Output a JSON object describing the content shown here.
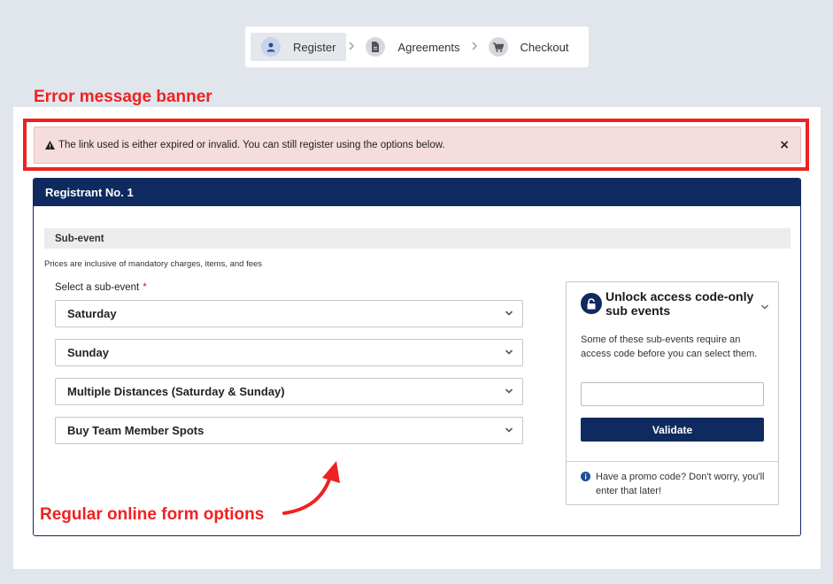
{
  "stepper": {
    "steps": [
      {
        "label": "Register",
        "icon": "user-icon",
        "active": true
      },
      {
        "label": "Agreements",
        "icon": "document-icon",
        "active": false
      },
      {
        "label": "Checkout",
        "icon": "cart-icon",
        "active": false
      }
    ]
  },
  "annotations": {
    "banner_label": "Error message banner",
    "form_label": "Regular online form options"
  },
  "banner": {
    "message": "The link used is either expired or invalid. You can still register using the options below.",
    "close_symbol": "×"
  },
  "registrant": {
    "title": "Registrant No. 1",
    "section_title": "Sub-event",
    "prices_note": "Prices are inclusive of mandatory charges, items, and fees",
    "select_label": "Select a sub-event",
    "required_mark": "*",
    "options": [
      "Saturday",
      "Sunday",
      "Multiple Distances (Saturday & Sunday)",
      "Buy Team Member Spots"
    ]
  },
  "access_code": {
    "title": "Unlock access code-only sub events",
    "description": "Some of these sub-events require an access code before you can select them.",
    "input_value": "",
    "validate_label": "Validate",
    "promo_text": "Have a promo code? Don't worry, you'll enter that later!"
  },
  "colors": {
    "navy": "#0f2a5f",
    "annotation_red": "#ee2222",
    "banner_bg": "#f5dddd",
    "page_bg": "#e1e6ed"
  }
}
